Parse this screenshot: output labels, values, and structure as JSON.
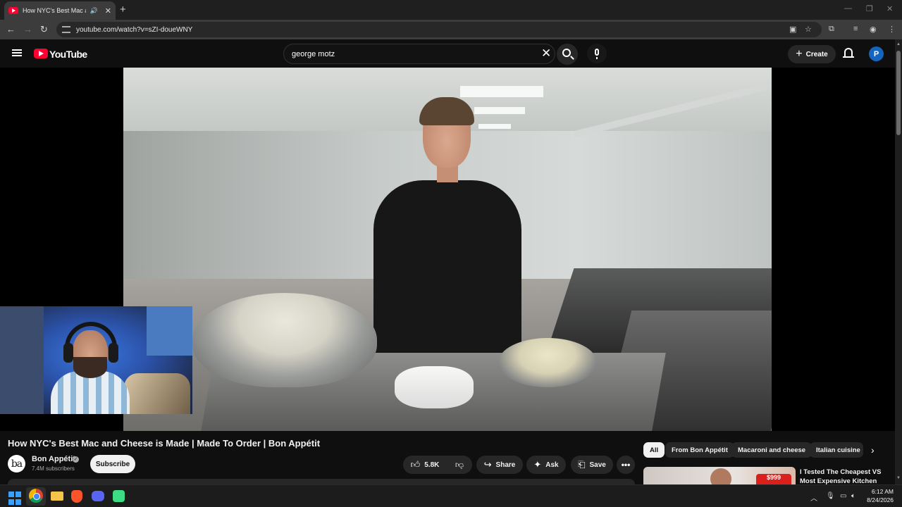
{
  "browser": {
    "tab_title": "How NYC's Best Mac and C",
    "tab_audio_icon": "speaker-icon",
    "url": "youtube.com/watch?v=sZI-doueWNY"
  },
  "youtube": {
    "logo_text": "YouTube",
    "search_query": "george motz",
    "create_label": "Create",
    "avatar_letter": "P"
  },
  "video": {
    "title": "How NYC's Best Mac and Cheese is Made | Made To Order | Bon Appétit",
    "channel": {
      "avatar_text": "ba",
      "name": "Bon Appétit",
      "verified_mark": "✓",
      "subscribers": "7.4M subscribers",
      "subscribe_label": "Subscribe"
    },
    "actions": {
      "likes": "5.8K",
      "share": "Share",
      "ask": "Ask",
      "save": "Save"
    }
  },
  "chips": [
    "All",
    "From Bon Appétit",
    "Macaroni and cheese",
    "Italian cuisine"
  ],
  "recommended": {
    "title": "I Tested The Cheapest VS Most Expensive Kitchen",
    "thumb_badge": "$999"
  },
  "taskbar": {
    "time": "6:12 AM",
    "date": "8/24/2026"
  },
  "colors": {
    "youtube_red": "#ff0033",
    "background": "#0f0f0f",
    "avatar_blue": "#1565c0"
  }
}
